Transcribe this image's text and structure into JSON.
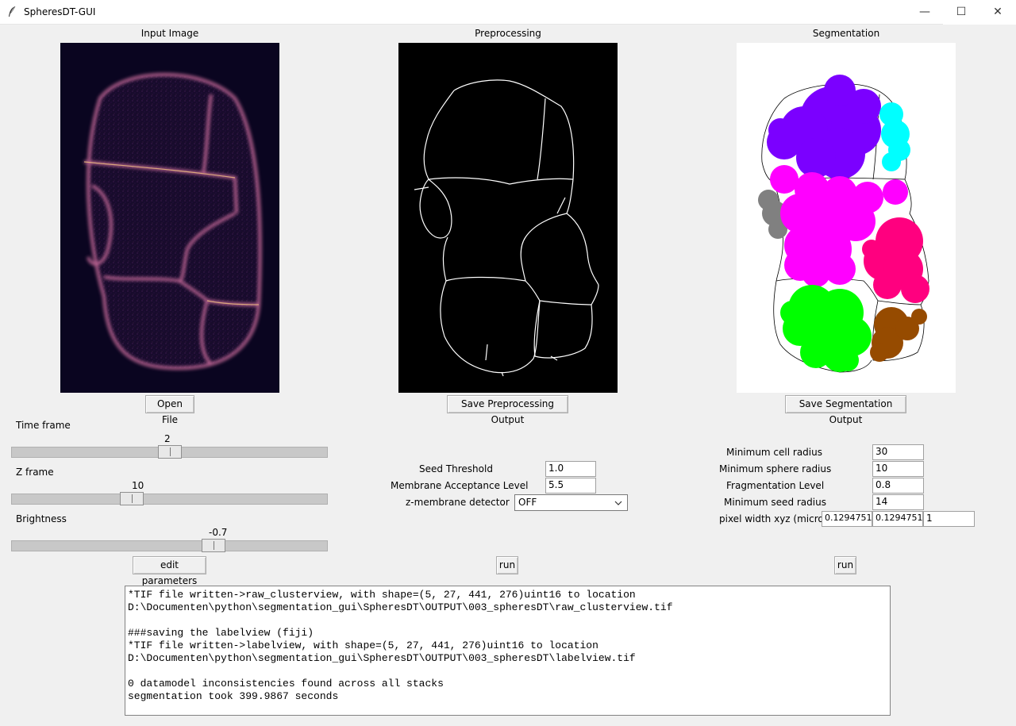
{
  "window": {
    "title": "SpheresDT-GUI",
    "minimize": "—",
    "maximize": "☐",
    "close": "✕"
  },
  "panels": {
    "input": {
      "title": "Input Image",
      "button": "Open File"
    },
    "preprocessing": {
      "title": "Preprocessing",
      "button": "Save Preprocessing Output"
    },
    "segmentation": {
      "title": "Segmentation",
      "button": "Save Segmentation Output"
    }
  },
  "sliders": [
    {
      "label": "Time frame",
      "value": "2",
      "fraction": 0.5
    },
    {
      "label": "Z frame",
      "value": "10",
      "fraction": 0.37
    },
    {
      "label": "Brightness",
      "value": "-0.7",
      "fraction": 0.65
    }
  ],
  "edit_parameters_label": "edit parameters",
  "preprocessing_params": {
    "seed_threshold": {
      "label": "Seed Threshold",
      "value": "1.0"
    },
    "membrane_acceptance": {
      "label": "Membrane Acceptance Level",
      "value": "5.5"
    },
    "z_membrane": {
      "label": "z-membrane detector",
      "value": "OFF"
    },
    "run_label": "run"
  },
  "segmentation_params": {
    "min_cell_radius": {
      "label": "Minimum cell radius",
      "value": "30"
    },
    "min_sphere_radius": {
      "label": "Minimum sphere radius",
      "value": "10"
    },
    "fragmentation": {
      "label": "Fragmentation Level",
      "value": "0.8"
    },
    "min_seed_radius": {
      "label": "Minimum seed radius",
      "value": "14"
    },
    "pixel_width": {
      "label": "pixel width xyz (micron)",
      "x": "0.1294751",
      "y": "0.1294751",
      "z": "1"
    },
    "run_label": "run"
  },
  "console": {
    "lines": [
      "*TIF file written->raw_clusterview, with shape=(5, 27, 441, 276)uint16 to location",
      "D:\\Documenten\\python\\segmentation_gui\\SpheresDT\\OUTPUT\\003_spheresDT\\raw_clusterview.tif",
      "",
      "###saving the labelview (fiji)",
      "*TIF file written->labelview, with shape=(5, 27, 441, 276)uint16 to location",
      "D:\\Documenten\\python\\segmentation_gui\\SpheresDT\\OUTPUT\\003_spheresDT\\labelview.tif",
      "",
      "0 datamodel inconsistencies found across all stacks",
      "segmentation took 399.9867 seconds"
    ]
  },
  "colors": {
    "cell_purple": "#7b00ff",
    "cell_cyan": "#00ffff",
    "cell_magenta": "#ff00ff",
    "cell_gray": "#808080",
    "cell_pink": "#ff007f",
    "cell_green": "#00ff00",
    "cell_brown": "#964b00"
  }
}
